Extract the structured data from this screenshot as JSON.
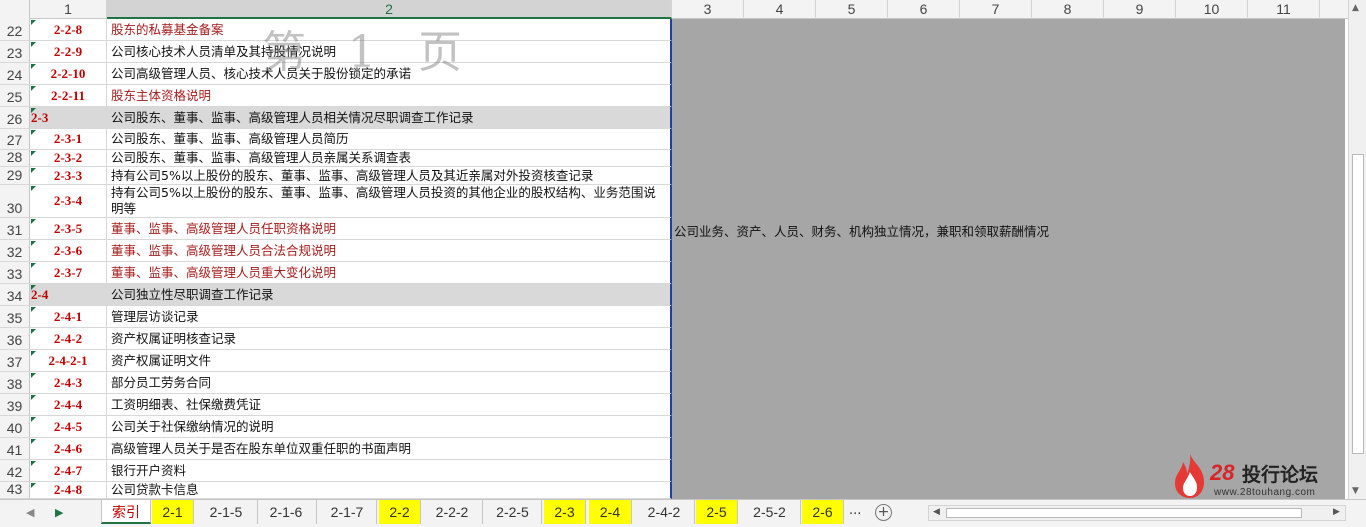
{
  "columns": [
    "1",
    "2",
    "3",
    "4",
    "5",
    "6",
    "7",
    "8",
    "9",
    "10",
    "11"
  ],
  "watermark": "第 1 页",
  "rows": [
    {
      "num": "22",
      "code": "2-2-8",
      "text": "股东的私募基金备案",
      "style": "red"
    },
    {
      "num": "23",
      "code": "2-2-9",
      "text": "公司核心技术人员清单及其持股情况说明",
      "style": "normal"
    },
    {
      "num": "24",
      "code": "2-2-10",
      "text": "公司高级管理人员、核心技术人员关于股份锁定的承诺",
      "style": "normal"
    },
    {
      "num": "25",
      "code": "2-2-11",
      "text": "股东主体资格说明",
      "style": "red"
    },
    {
      "num": "26",
      "code": "2-3",
      "text": "公司股东、董事、监事、高级管理人员相关情况尽职调查工作记录",
      "style": "section"
    },
    {
      "num": "27",
      "code": "2-3-1",
      "text": "公司股东、董事、监事、高级管理人员简历",
      "style": "normal"
    },
    {
      "num": "28",
      "code": "2-3-2",
      "text": "公司股东、董事、监事、高级管理人员亲属关系调查表",
      "style": "normal"
    },
    {
      "num": "29",
      "code": "2-3-3",
      "text": "持有公司5%以上股份的股东、董事、监事、高级管理人员及其近亲属对外投资核查记录",
      "style": "normal"
    },
    {
      "num": "30",
      "code": "2-3-4",
      "text": "持有公司5%以上股份的股东、董事、监事、高级管理人员投资的其他企业的股权结构、业务范围说明等",
      "style": "normal"
    },
    {
      "num": "31",
      "code": "2-3-5",
      "text": "董事、监事、高级管理人员任职资格说明",
      "style": "red"
    },
    {
      "num": "32",
      "code": "2-3-6",
      "text": "董事、监事、高级管理人员合法合规说明",
      "style": "red"
    },
    {
      "num": "33",
      "code": "2-3-7",
      "text": "董事、监事、高级管理人员重大变化说明",
      "style": "red"
    },
    {
      "num": "34",
      "code": "2-4",
      "text": "公司独立性尽职调查工作记录",
      "style": "section"
    },
    {
      "num": "35",
      "code": "2-4-1",
      "text": "管理层访谈记录",
      "style": "normal"
    },
    {
      "num": "36",
      "code": "2-4-2",
      "text": "资产权属证明核查记录",
      "style": "normal"
    },
    {
      "num": "37",
      "code": "2-4-2-1",
      "text": "资产权属证明文件",
      "style": "normal"
    },
    {
      "num": "38",
      "code": "2-4-3",
      "text": "部分员工劳务合同",
      "style": "normal"
    },
    {
      "num": "39",
      "code": "2-4-4",
      "text": "工资明细表、社保缴费凭证",
      "style": "normal"
    },
    {
      "num": "40",
      "code": "2-4-5",
      "text": "公司关于社保缴纳情况的说明",
      "style": "normal"
    },
    {
      "num": "41",
      "code": "2-4-6",
      "text": "高级管理人员关于是否在股东单位双重任职的书面声明",
      "style": "normal"
    },
    {
      "num": "42",
      "code": "2-4-7",
      "text": "银行开户资料",
      "style": "normal"
    },
    {
      "num": "43",
      "code": "2-4-8",
      "text": "公司贷款卡信息",
      "style": "normal"
    }
  ],
  "gray_note": "公司业务、资产、人员、财务、机构独立情况，兼职和领取薪酬情况",
  "tabs": [
    {
      "label": "索引",
      "style": "active"
    },
    {
      "label": "2-1",
      "style": "yellow"
    },
    {
      "label": "2-1-5",
      "style": "normal"
    },
    {
      "label": "2-1-6",
      "style": "normal"
    },
    {
      "label": "2-1-7",
      "style": "normal"
    },
    {
      "label": "2-2",
      "style": "yellow"
    },
    {
      "label": "2-2-2",
      "style": "normal"
    },
    {
      "label": "2-2-5",
      "style": "normal"
    },
    {
      "label": "2-3",
      "style": "yellow"
    },
    {
      "label": "2-4",
      "style": "yellow"
    },
    {
      "label": "2-4-2",
      "style": "normal"
    },
    {
      "label": "2-5",
      "style": "yellow"
    },
    {
      "label": "2-5-2",
      "style": "normal"
    },
    {
      "label": "2-6",
      "style": "yellow"
    }
  ],
  "more_tabs": "...",
  "add_sheet": "+",
  "logo": {
    "num": "28",
    "name": "投行论坛",
    "url": "www.28touhang.com"
  },
  "colors": {
    "accent": "#217346",
    "red_text": "#c00000",
    "tab_highlight": "#ffff00",
    "print_area": "#a6a6a6"
  },
  "icons": {
    "add_sheet": "plus-circle-icon",
    "prev": "triangle-left-icon",
    "next": "triangle-right-icon"
  }
}
